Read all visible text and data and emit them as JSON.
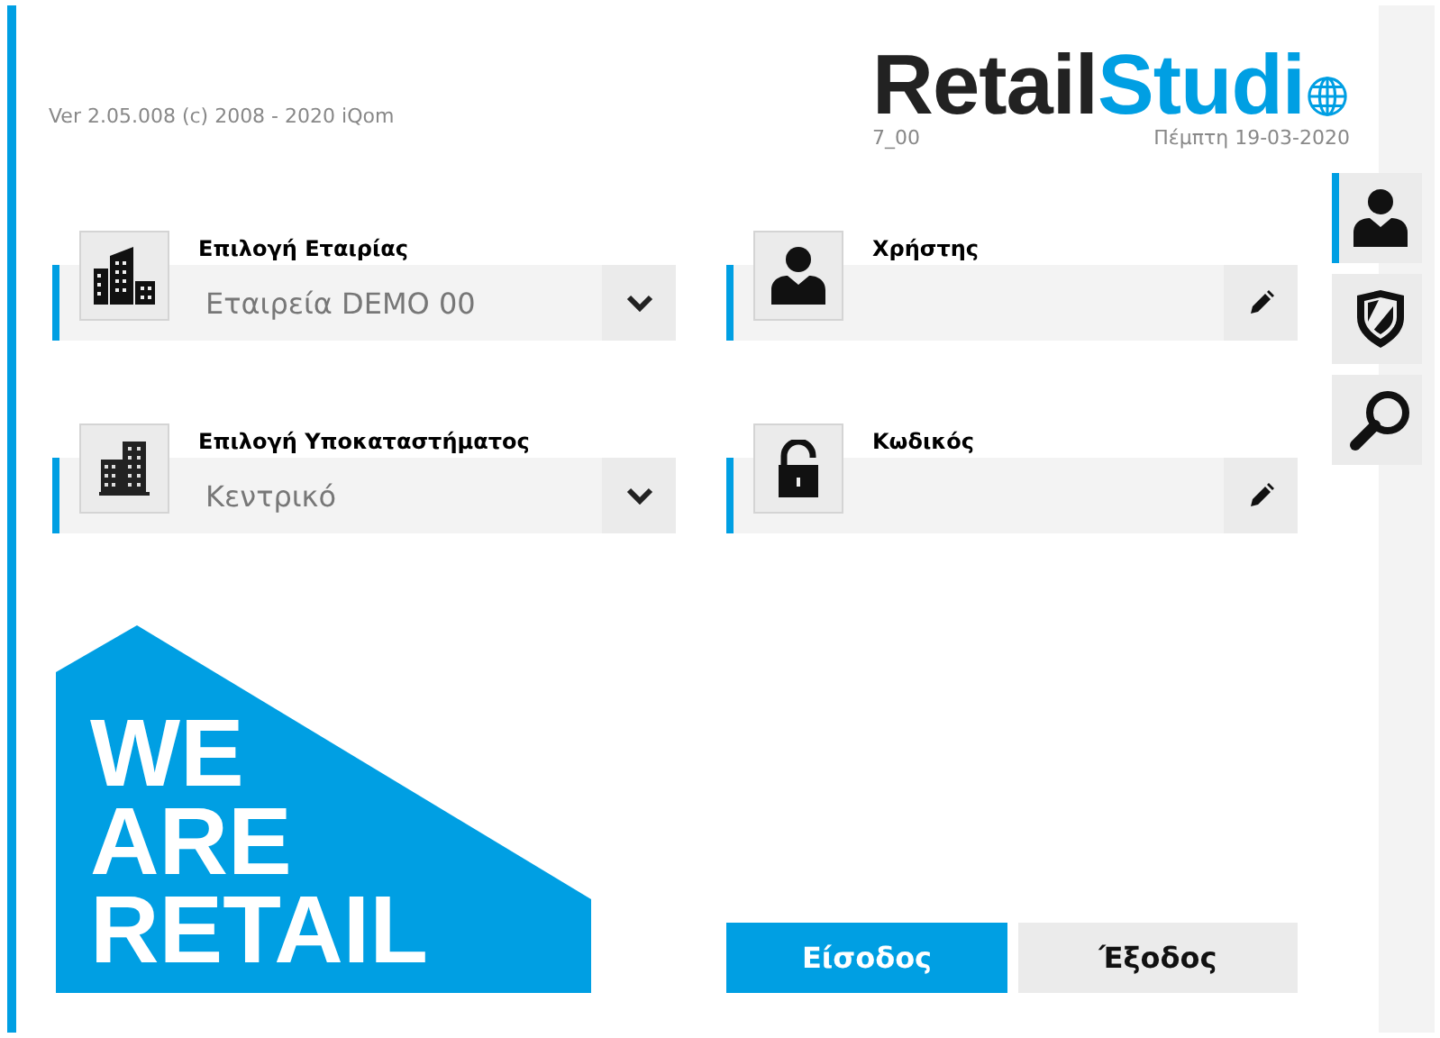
{
  "header": {
    "version": "Ver 2.05.008 (c) 2008 - 2020 iQom",
    "logo": {
      "dark": "Retail",
      "blue": "Studi"
    },
    "station": "7_00",
    "date": "Πέμπτη 19-03-2020"
  },
  "left_fields": [
    {
      "kind": "select",
      "label": "Επιλογή Εταιρίας",
      "value": "Εταιρεία DEMO 00"
    },
    {
      "kind": "select",
      "label": "Επιλογή Υποκαταστήματος",
      "value": "Κεντρικό"
    }
  ],
  "right_fields": [
    {
      "kind": "text",
      "label": "Χρήστης"
    },
    {
      "kind": "text",
      "label": "Κωδικός"
    }
  ],
  "side_tabs": [
    {
      "selected": true
    },
    {
      "selected": false
    },
    {
      "selected": false
    }
  ],
  "banner": {
    "lines": [
      "WE",
      "ARE",
      "RETAIL"
    ]
  },
  "buttons": [
    {
      "kind": "primary",
      "label": "Είσοδος"
    },
    {
      "kind": "secondary",
      "label": "Έξοδος"
    }
  ]
}
